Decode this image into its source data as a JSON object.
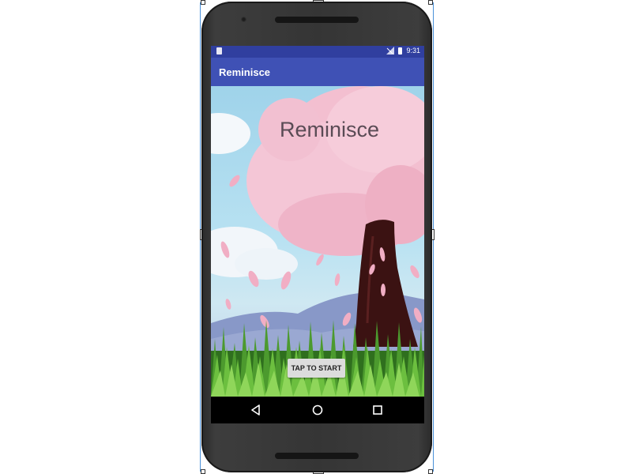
{
  "status_bar": {
    "time": "9:31",
    "icons": [
      "sim-card-icon",
      "signal-icon",
      "battery-icon"
    ]
  },
  "app_bar": {
    "title": "Reminisce"
  },
  "splash": {
    "title": "Reminisce",
    "start_button_label": "TAP TO START"
  },
  "nav_bar": {
    "buttons": [
      "back-icon",
      "home-icon",
      "recents-icon"
    ]
  },
  "colors": {
    "status_bar": "#303f9f",
    "app_bar": "#3f51b5",
    "blossom": "#f2b8cc",
    "grass": "#3f8f2a",
    "trunk": "#3b1212"
  }
}
